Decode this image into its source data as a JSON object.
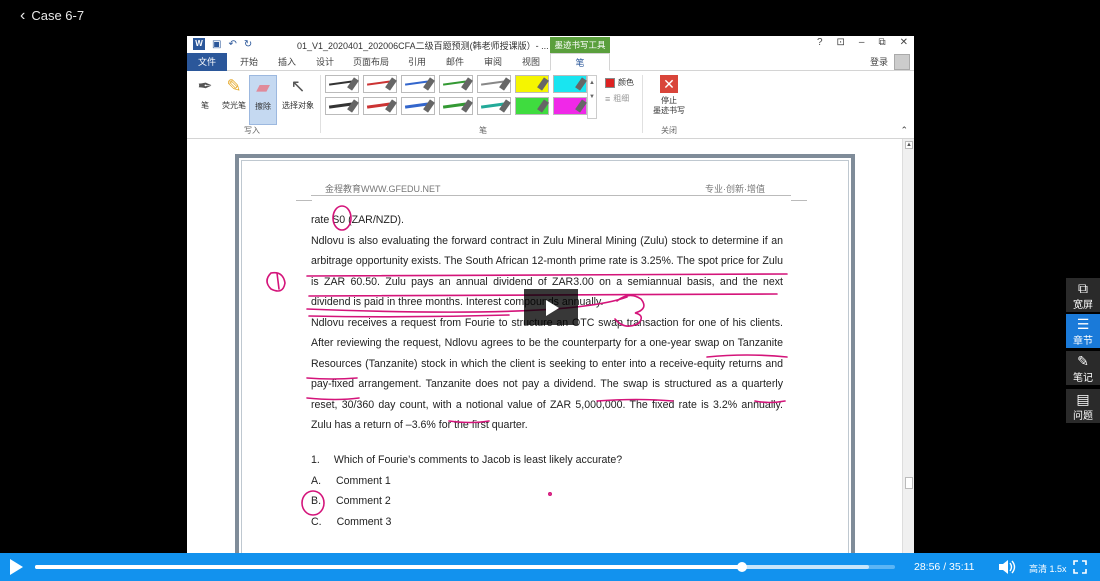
{
  "topbar": {
    "back_label": "Case 6-7"
  },
  "word": {
    "doc_title": "01_V1_2020401_202006CFA二级百题预测(韩老师授课版）- ...",
    "context_tab": "墨迹书写工具",
    "login": "登录",
    "window_controls": [
      "?",
      "⊡",
      "–",
      "⧉",
      "✕"
    ],
    "tabs": [
      "文件",
      "开始",
      "插入",
      "设计",
      "页面布局",
      "引用",
      "邮件",
      "审阅",
      "视图",
      "笔"
    ],
    "active_tab": "笔",
    "ribbon": {
      "tools": [
        "笔",
        "荧光笔",
        "擦除",
        "选择对象"
      ],
      "group_write": "写入",
      "group_pens": "笔",
      "group_close": "关闭",
      "color_label": "颜色",
      "thickness_label": "粗细",
      "stop_label_1": "停止",
      "stop_label_2": "墨迹书写"
    },
    "page": {
      "header_left": "金程教育WWW.GFEDU.NET",
      "header_right": "专业·创新·增值",
      "paragraphs": [
        "rate S0 (ZAR/NZD).",
        "Ndlovu is also evaluating the forward contract in Zulu Mineral Mining (Zulu) stock to determine if an arbitrage opportunity exists. The South African 12-month prime rate is 3.25%. The spot price for Zulu is ZAR 60.50. Zulu pays an annual dividend of ZAR3.00 on a semiannual basis, and the next dividend is paid in three months. Interest compounds annually.",
        "Ndlovu receives a request from Fourie to structure an OTC swap transaction for one of his clients. After reviewing the request, Ndlovu agrees to be the counterparty for a one-year swap on Tanzanite Resources (Tanzanite) stock in which the client is seeking to enter into a receive-equity returns and pay-fixed arrangement. Tanzanite does not pay a dividend. The swap is structured as a quarterly reset, 30/360 day count, with a notional value of ZAR 5,000,000. The fixed rate is 3.2% annually. Zulu has a return of –3.6% for the first quarter."
      ],
      "question": {
        "number": "1.",
        "text": "Which of Fourie’s comments to Jacob is least likely accurate?",
        "options": [
          {
            "letter": "A.",
            "text": "Comment 1"
          },
          {
            "letter": "B.",
            "text": "Comment 2"
          },
          {
            "letter": "C.",
            "text": "Comment 3"
          }
        ]
      }
    }
  },
  "side_buttons": [
    {
      "icon": "widescreen-icon",
      "label": "宽屏"
    },
    {
      "icon": "chapters-icon",
      "label": "章节"
    },
    {
      "icon": "notes-icon",
      "label": "笔记"
    },
    {
      "icon": "questions-icon",
      "label": "问题"
    }
  ],
  "player": {
    "current_time": "28:56",
    "total_time": "35:11",
    "time_display": "28:56 / 35:11",
    "progress_fraction": 0.822,
    "buffered_fraction": 0.97,
    "quality_speed": "高清 1.5x"
  },
  "colors": {
    "player_bar": "#1292ee",
    "active_side": "#1a7ad9",
    "word_blue": "#2b579a",
    "ink": "#d4147a"
  }
}
